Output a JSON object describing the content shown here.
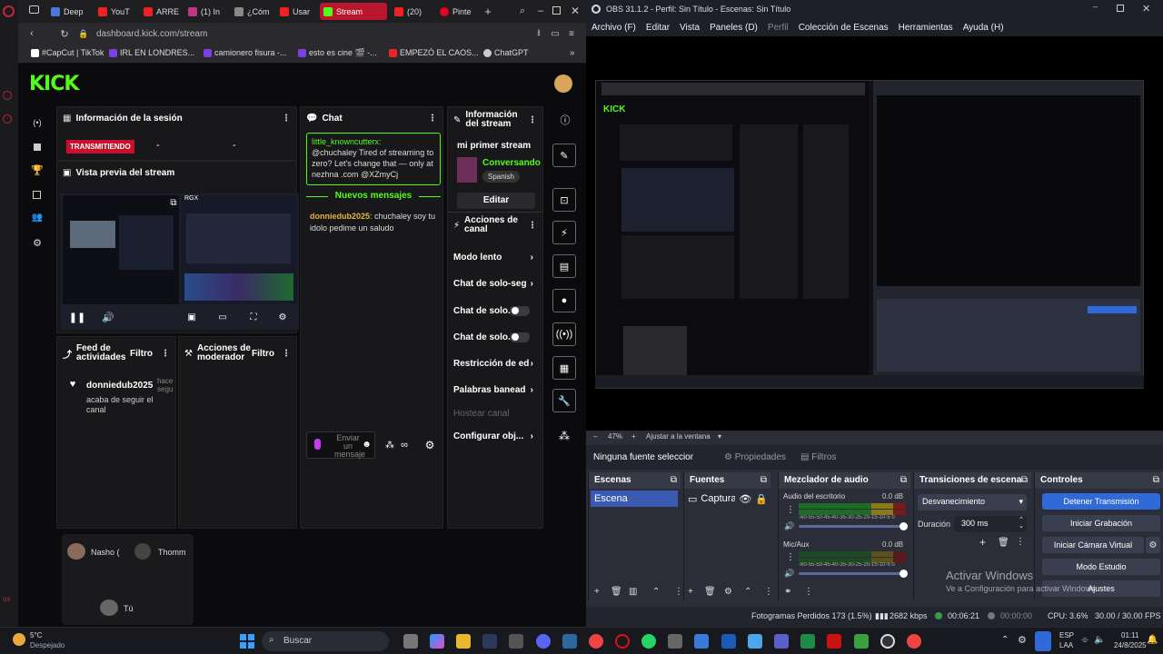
{
  "browser": {
    "tabs": [
      {
        "label": "Deep",
        "color": "#4a78d8"
      },
      {
        "label": "YouT",
        "color": "#e22"
      },
      {
        "label": "ARRE",
        "color": "#e22"
      },
      {
        "label": "(1) In",
        "color": "#c13584"
      },
      {
        "label": "¿Cóm",
        "color": "#888"
      },
      {
        "label": "Usar",
        "color": "#e22"
      },
      {
        "label": "Stream",
        "color": "#53fc18"
      },
      {
        "label": "(20)",
        "color": "#e22"
      },
      {
        "label": "Pinte",
        "color": "#e60023"
      }
    ],
    "url": "dashboard.kick.com/stream",
    "bookmarks": [
      "#CapCut | TikTok",
      "IRL EN LONDRES...",
      "camionero fisura -...",
      "esto es cine 🎬 -...",
      "EMPEZÓ EL CAOS...",
      "ChatGPT"
    ]
  },
  "kick": {
    "logo": "KICK",
    "session": {
      "title": "Información de la sesión",
      "live_badge": "TRANSMITIENDO",
      "stat1": "-",
      "stat2": "-"
    },
    "preview": {
      "title": "Vista previa del stream",
      "overlay": "RGX"
    },
    "feed": {
      "title": "Feed de actividades",
      "filter": "Filtro",
      "user": "donniedub2025",
      "time": "hace segu",
      "action": "acaba de seguir el canal"
    },
    "mod": {
      "title": "Acciones de moderador",
      "filter": "Filtro"
    },
    "chat": {
      "title": "Chat",
      "pinned_user": "little_knowncutterx:",
      "pinned_text": "@chuchaley Tired of streaming to zero? Let's change that — only at nezhna .com @XZmyCj",
      "new_messages": "Nuevos mensajes",
      "msg_user": "donniedub2025",
      "msg_text": ": chuchaley soy tu idolo pedime un saludo",
      "input_placeholder": "Enviar un mensaje"
    },
    "info": {
      "title": "Información del stream",
      "stream_title": "mi primer stream",
      "category": "Conversando",
      "language": "Spanish",
      "edit": "Editar"
    },
    "actions": {
      "title": "Acciones de canal",
      "items": [
        "Modo lento",
        "Chat de solo-seg",
        "Chat de solo...",
        "Chat de solo...",
        "Restricción de ed",
        "Palabras banead",
        "Hostear canal",
        "Configurar obj..."
      ]
    },
    "guests": [
      "Nasho (",
      "Thomm",
      "Tú"
    ]
  },
  "obs": {
    "title": "OBS 31.1.2 - Perfil: Sin Título - Escenas: Sin Título",
    "menu": [
      "Archivo (F)",
      "Editar",
      "Vista",
      "Paneles (D)",
      "Perfil",
      "Colección de Escenas",
      "Herramientas",
      "Ayuda (H)"
    ],
    "zoom": "47%",
    "fit": "Ajustar a la ventana",
    "no_source": "Ninguna fuente seleccionada",
    "properties": "Propiedades",
    "filters": "Filtros",
    "scenes": {
      "title": "Escenas",
      "item": "Escena"
    },
    "sources": {
      "title": "Fuentes",
      "item": "Captura d"
    },
    "mixer": {
      "title": "Mezclador de audio",
      "ch1": "Audio del escritorio",
      "ch1_db": "0.0 dB",
      "ch2": "Mic/Aux",
      "ch2_db": "0.0 dB",
      "scale": "-60-55-50-45-40-35-30-25-20-15-10-5 0"
    },
    "transitions": {
      "title": "Transiciones de escena",
      "type": "Desvanecimiento",
      "duration_label": "Duración",
      "duration": "300 ms"
    },
    "controls": {
      "title": "Controles",
      "stop": "Detener Transmisión",
      "record": "Iniciar Grabación",
      "vcam": "Iniciar Cámara Virtual",
      "studio": "Modo Estudio",
      "settings": "Ajustes",
      "colors": {
        "stop": "#2f6ad8"
      }
    },
    "watermark": {
      "title": "Activar Windows",
      "sub": "Ve a Configuración para activar Windows."
    },
    "status": {
      "dropped": "Fotogramas Perdidos 173 (1.5%)",
      "kbps": "2682 kbps",
      "live_time": "00:06:21",
      "rec_time": "00:00:00",
      "cpu": "CPU: 3.6%",
      "fps": "30.00 / 30.00 FPS"
    }
  },
  "taskbar": {
    "weather_temp": "5°C",
    "weather_desc": "Despejado",
    "search": "Buscar",
    "lang": "ESP",
    "region": "LAA",
    "time": "01:11",
    "date": "24/8/2025"
  }
}
